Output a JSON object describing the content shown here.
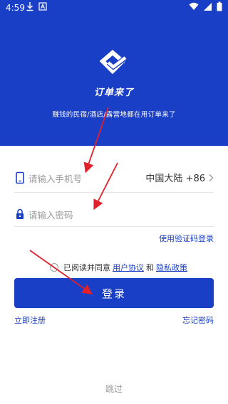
{
  "status_bar": {
    "time": "4:59",
    "left_icons": [
      "download-icon",
      "a-box-icon"
    ],
    "right_icons": [
      "wifi-icon",
      "signal-icon",
      "battery-icon"
    ]
  },
  "brand": {
    "name": "订单来了",
    "slogan": "赚钱的民宿/酒店/露营地都在用订单来了",
    "accent": "#1a3fc7"
  },
  "form": {
    "phone_placeholder": "请输入手机号",
    "region": "中国大陆 +86",
    "password_placeholder": "请输入密码",
    "sms_login": "使用验证码登录"
  },
  "agreement": {
    "prefix": "已阅读并同意",
    "user_agreement": "用户协议",
    "and": "和",
    "privacy_policy": "隐私政策"
  },
  "actions": {
    "login": "登录",
    "register": "立即注册",
    "forgot_password": "忘记密码",
    "skip": "跳过"
  },
  "annotation_color": "#e0202a"
}
